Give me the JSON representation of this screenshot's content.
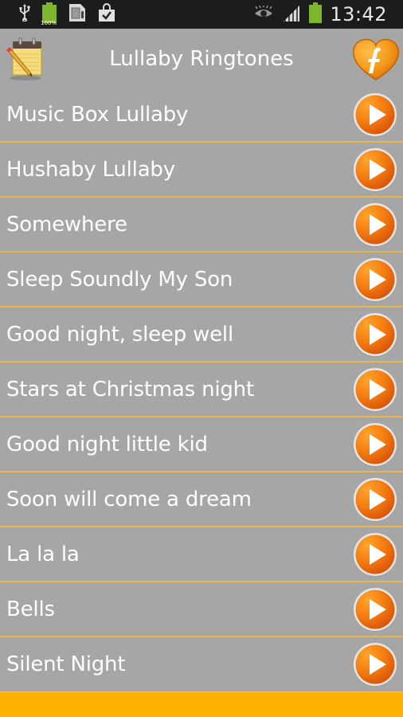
{
  "status_bar": {
    "icons": [
      "usb-icon",
      "battery-full-icon",
      "sd-card-icon",
      "shopping-bag-check-icon"
    ],
    "battery_percent_label": "100%",
    "right_icons": [
      "eye-icon",
      "signal-icon",
      "battery-icon"
    ],
    "time": "13:42"
  },
  "header": {
    "title": "Lullaby Ringtones",
    "left_icon": "notepad-pencil-icon",
    "right_icon": "heart-favorite-icon"
  },
  "ringtones": [
    {
      "label": "Music Box Lullaby"
    },
    {
      "label": "Hushaby Lullaby"
    },
    {
      "label": "Somewhere"
    },
    {
      "label": "Sleep Soundly My Son"
    },
    {
      "label": "Good night, sleep well"
    },
    {
      "label": "Stars at Christmas night"
    },
    {
      "label": "Good night little kid"
    },
    {
      "label": "Soon will come a dream"
    },
    {
      "label": "La la la"
    },
    {
      "label": "Bells"
    },
    {
      "label": "Silent Night"
    }
  ],
  "colors": {
    "background": "#a6a6a6",
    "separator": "#e6b84a",
    "accent": "#ff8a00",
    "bottom_bar": "#ffb000"
  }
}
